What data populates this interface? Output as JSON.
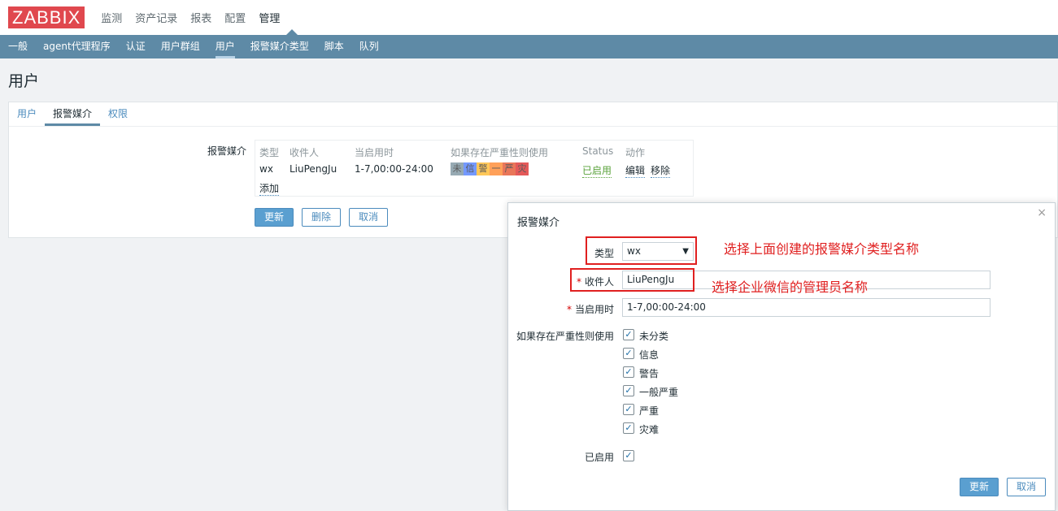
{
  "logo": "ZABBIX",
  "main_nav": [
    "监测",
    "资产记录",
    "报表",
    "配置",
    "管理"
  ],
  "sub_nav": [
    "一般",
    "agent代理程序",
    "认证",
    "用户群组",
    "用户",
    "报警媒介类型",
    "脚本",
    "队列"
  ],
  "page_title": "用户",
  "tabs": [
    "用户",
    "报警媒介",
    "权限"
  ],
  "media": {
    "label": "报警媒介",
    "headers": [
      "类型",
      "收件人",
      "当启用时",
      "如果存在严重性则使用",
      "Status",
      "动作"
    ],
    "row": {
      "type": "wx",
      "sendto": "LiuPengJu",
      "period": "1-7,00:00-24:00",
      "severities": [
        "未",
        "信",
        "警",
        "一",
        "严",
        "灾"
      ],
      "status": "已启用",
      "edit": "编辑",
      "remove": "移除"
    },
    "add": "添加"
  },
  "buttons": {
    "update": "更新",
    "delete": "删除",
    "cancel": "取消"
  },
  "severity_colors": [
    "#97AAB3",
    "#7499FF",
    "#FFC859",
    "#FFA059",
    "#E97659",
    "#E45959"
  ],
  "dialog": {
    "title": "报警媒介",
    "close": "×",
    "type_label": "类型",
    "type_value": "wx",
    "sendto_label": "收件人",
    "sendto_value": "LiuPengJu",
    "period_label": "当启用时",
    "period_value": "1-7,00:00-24:00",
    "severity_label": "如果存在严重性则使用",
    "severities": [
      "未分类",
      "信息",
      "警告",
      "一般严重",
      "严重",
      "灾难"
    ],
    "enabled_label": "已启用",
    "update": "更新",
    "cancel": "取消"
  },
  "annotations": [
    "选择上面创建的报警媒介类型名称",
    "选择企业微信的管理员名称"
  ]
}
